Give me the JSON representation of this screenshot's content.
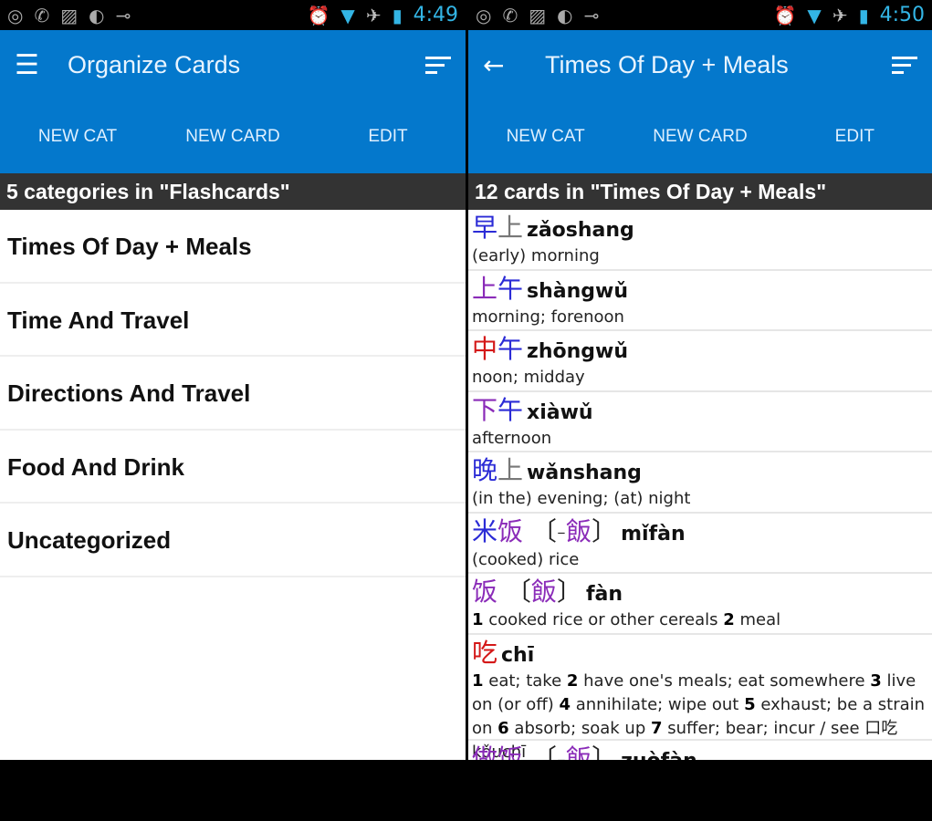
{
  "left": {
    "status": {
      "time": "4:49"
    },
    "title": "Organize Cards",
    "tabs": [
      "NEW CAT",
      "NEW CARD",
      "EDIT"
    ],
    "subheader": "5 categories in \"Flashcards\"",
    "categories": [
      "Times Of Day + Meals",
      "Time And Travel",
      "Directions And Travel",
      "Food And Drink",
      "Uncategorized"
    ]
  },
  "right": {
    "status": {
      "time": "4:50"
    },
    "title": "Times Of Day + Meals",
    "tabs": [
      "NEW CAT",
      "NEW CARD",
      "EDIT"
    ],
    "subheader": "12 cards in \"Times Of Day + Meals\"",
    "cards": [
      {
        "hanzi": [
          {
            "t": "早",
            "c": "#2b2bd6"
          },
          {
            "t": "上",
            "c": "#777777"
          }
        ],
        "pinyin": "zǎoshang",
        "def": [
          [
            "",
            "(early) morning"
          ]
        ]
      },
      {
        "hanzi": [
          {
            "t": "上",
            "c": "#8a2bb8"
          },
          {
            "t": "午",
            "c": "#2b2bd6"
          }
        ],
        "pinyin": "shàngwǔ",
        "def": [
          [
            "",
            "morning; forenoon"
          ]
        ]
      },
      {
        "hanzi": [
          {
            "t": "中",
            "c": "#d41818"
          },
          {
            "t": "午",
            "c": "#2b2bd6"
          }
        ],
        "pinyin": "zhōngwǔ",
        "def": [
          [
            "",
            "noon; midday"
          ]
        ]
      },
      {
        "hanzi": [
          {
            "t": "下",
            "c": "#8a2bb8"
          },
          {
            "t": "午",
            "c": "#2b2bd6"
          }
        ],
        "pinyin": "xiàwǔ",
        "def": [
          [
            "",
            "afternoon"
          ]
        ]
      },
      {
        "hanzi": [
          {
            "t": "晚",
            "c": "#2b2bd6"
          },
          {
            "t": "上",
            "c": "#777777"
          }
        ],
        "pinyin": "wǎnshang",
        "def": [
          [
            "",
            "(in the) evening; (at) night"
          ]
        ]
      },
      {
        "hanzi": [
          {
            "t": "米",
            "c": "#2b2bd6"
          },
          {
            "t": "饭",
            "c": "#8a2bb8"
          },
          {
            "t": " 〔-",
            "c": "#222222"
          },
          {
            "t": "飯",
            "c": "#8a2bb8"
          },
          {
            "t": "〕",
            "c": "#222222"
          }
        ],
        "pinyin": "mǐfàn",
        "def": [
          [
            "",
            "(cooked) rice"
          ]
        ]
      },
      {
        "hanzi": [
          {
            "t": "饭",
            "c": "#8a2bb8"
          },
          {
            "t": " 〔",
            "c": "#222222"
          },
          {
            "t": "飯",
            "c": "#8a2bb8"
          },
          {
            "t": "〕",
            "c": "#222222"
          }
        ],
        "pinyin": "fàn",
        "def": [
          [
            "1",
            " cooked rice or other cereals  "
          ],
          [
            "2",
            " meal"
          ]
        ]
      },
      {
        "hanzi": [
          {
            "t": "吃",
            "c": "#d41818"
          }
        ],
        "pinyin": "chī",
        "def": [
          [
            "1",
            " eat; take  "
          ],
          [
            "2",
            " have one's meals; eat somewhere  "
          ],
          [
            "3",
            " live on (or off)  "
          ],
          [
            "4",
            " annihilate; wipe out  "
          ],
          [
            "5",
            " exhaust; be a strain on "
          ],
          [
            "6",
            " absorb; soak up  "
          ],
          [
            "7",
            " suffer; bear; incur  / see 口吃 kǒuchī"
          ]
        ]
      },
      {
        "hanzi": [
          {
            "t": "做",
            "c": "#8a2bb8"
          },
          {
            "t": "饭",
            "c": "#8a2bb8"
          },
          {
            "t": " 〔-",
            "c": "#222222"
          },
          {
            "t": "飯",
            "c": "#8a2bb8"
          },
          {
            "t": "〕",
            "c": "#222222"
          }
        ],
        "pinyin": "zuòfàn",
        "def": []
      }
    ]
  }
}
